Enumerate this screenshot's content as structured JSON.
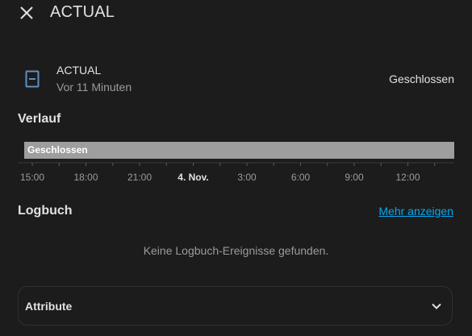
{
  "header": {
    "title": "ACTUAL"
  },
  "entity": {
    "name": "ACTUAL",
    "last_changed": "Vor 11 Minuten",
    "state": "Geschlossen",
    "icon": "door-closed-icon"
  },
  "history": {
    "title": "Verlauf"
  },
  "logbook": {
    "title": "Logbuch",
    "more_label": "Mehr anzeigen",
    "empty_message": "Keine Logbuch-Ereignisse gefunden."
  },
  "attributes": {
    "label": "Attribute"
  },
  "colors": {
    "background": "#1c1c1c",
    "text": "#e1e1e1",
    "secondary_text": "#9b9b9b",
    "link": "#03a9f4",
    "timeline_bar": "#9e9e9e",
    "icon": "#5e8fc2"
  },
  "chart_data": {
    "type": "timeline",
    "xlabel": "",
    "ylabel": "",
    "ticks": [
      {
        "label": "15:00",
        "bold": false
      },
      {
        "label": "18:00",
        "bold": false
      },
      {
        "label": "21:00",
        "bold": false
      },
      {
        "label": "4. Nov.",
        "bold": true
      },
      {
        "label": "3:00",
        "bold": false
      },
      {
        "label": "6:00",
        "bold": false
      },
      {
        "label": "9:00",
        "bold": false
      },
      {
        "label": "12:00",
        "bold": false
      }
    ],
    "series": [
      {
        "segments": [
          {
            "state": "Geschlossen",
            "start": "15:00",
            "end": "12:00+"
          }
        ]
      }
    ]
  }
}
